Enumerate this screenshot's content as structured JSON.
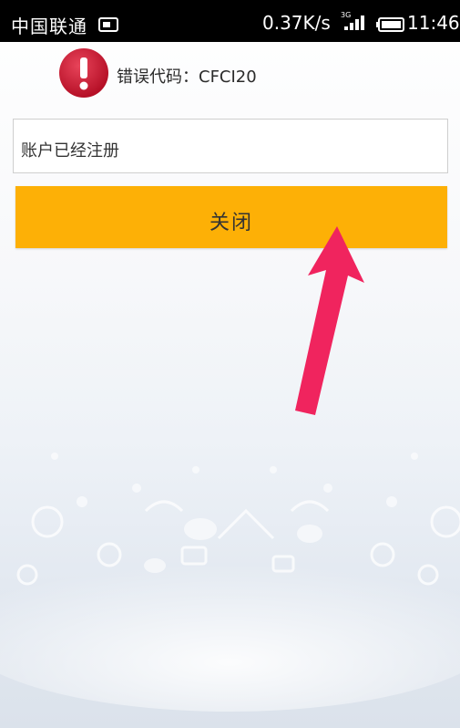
{
  "status_bar": {
    "carrier": "中国联通",
    "net_speed": "0.37K/s",
    "network_type": "3G",
    "time": "11:46",
    "icons": [
      "sim-card-icon",
      "signal-icon",
      "battery-icon"
    ]
  },
  "dialog": {
    "error_code": "错误代码：CFCI20",
    "message": "账户已经注册",
    "close_label": "关闭",
    "icon": "exclamation-icon"
  },
  "colors": {
    "status_bar_bg": "#000000",
    "error_red": "#c8102e",
    "button_bg": "#fdb006",
    "arrow_pink": "#f0245e"
  }
}
